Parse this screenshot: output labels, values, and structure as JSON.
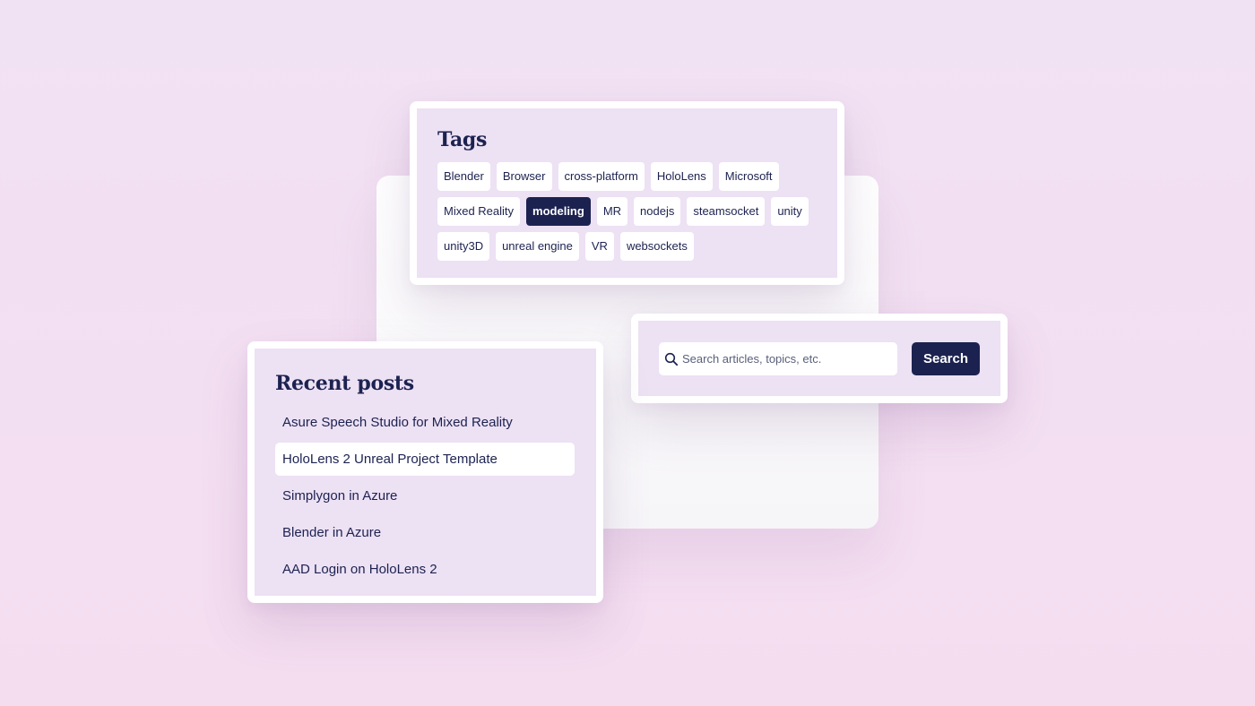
{
  "tags": {
    "title": "Tags",
    "items": [
      {
        "label": "Blender",
        "active": false
      },
      {
        "label": "Browser",
        "active": false
      },
      {
        "label": "cross-platform",
        "active": false
      },
      {
        "label": "HoloLens",
        "active": false
      },
      {
        "label": "Microsoft",
        "active": false
      },
      {
        "label": "Mixed Reality",
        "active": false
      },
      {
        "label": "modeling",
        "active": true
      },
      {
        "label": "MR",
        "active": false
      },
      {
        "label": "nodejs",
        "active": false
      },
      {
        "label": "steamsocket",
        "active": false
      },
      {
        "label": "unity",
        "active": false
      },
      {
        "label": "unity3D",
        "active": false
      },
      {
        "label": "unreal engine",
        "active": false
      },
      {
        "label": "VR",
        "active": false
      },
      {
        "label": "websockets",
        "active": false
      }
    ]
  },
  "search": {
    "icon": "search-icon",
    "placeholder": "Search articles, topics, etc.",
    "value": "",
    "button_label": "Search"
  },
  "recent_posts": {
    "title": "Recent posts",
    "items": [
      {
        "label": "Asure Speech Studio for Mixed Reality",
        "highlighted": false
      },
      {
        "label": "HoloLens 2 Unreal Project Template",
        "highlighted": true
      },
      {
        "label": "Simplygon in Azure",
        "highlighted": false
      },
      {
        "label": "Blender in Azure",
        "highlighted": false
      },
      {
        "label": "AAD Login on HoloLens 2",
        "highlighted": false
      }
    ]
  },
  "colors": {
    "accent": "#1c2250",
    "panel_background": "#ede1f4",
    "page_background": "#f2e0f2"
  }
}
